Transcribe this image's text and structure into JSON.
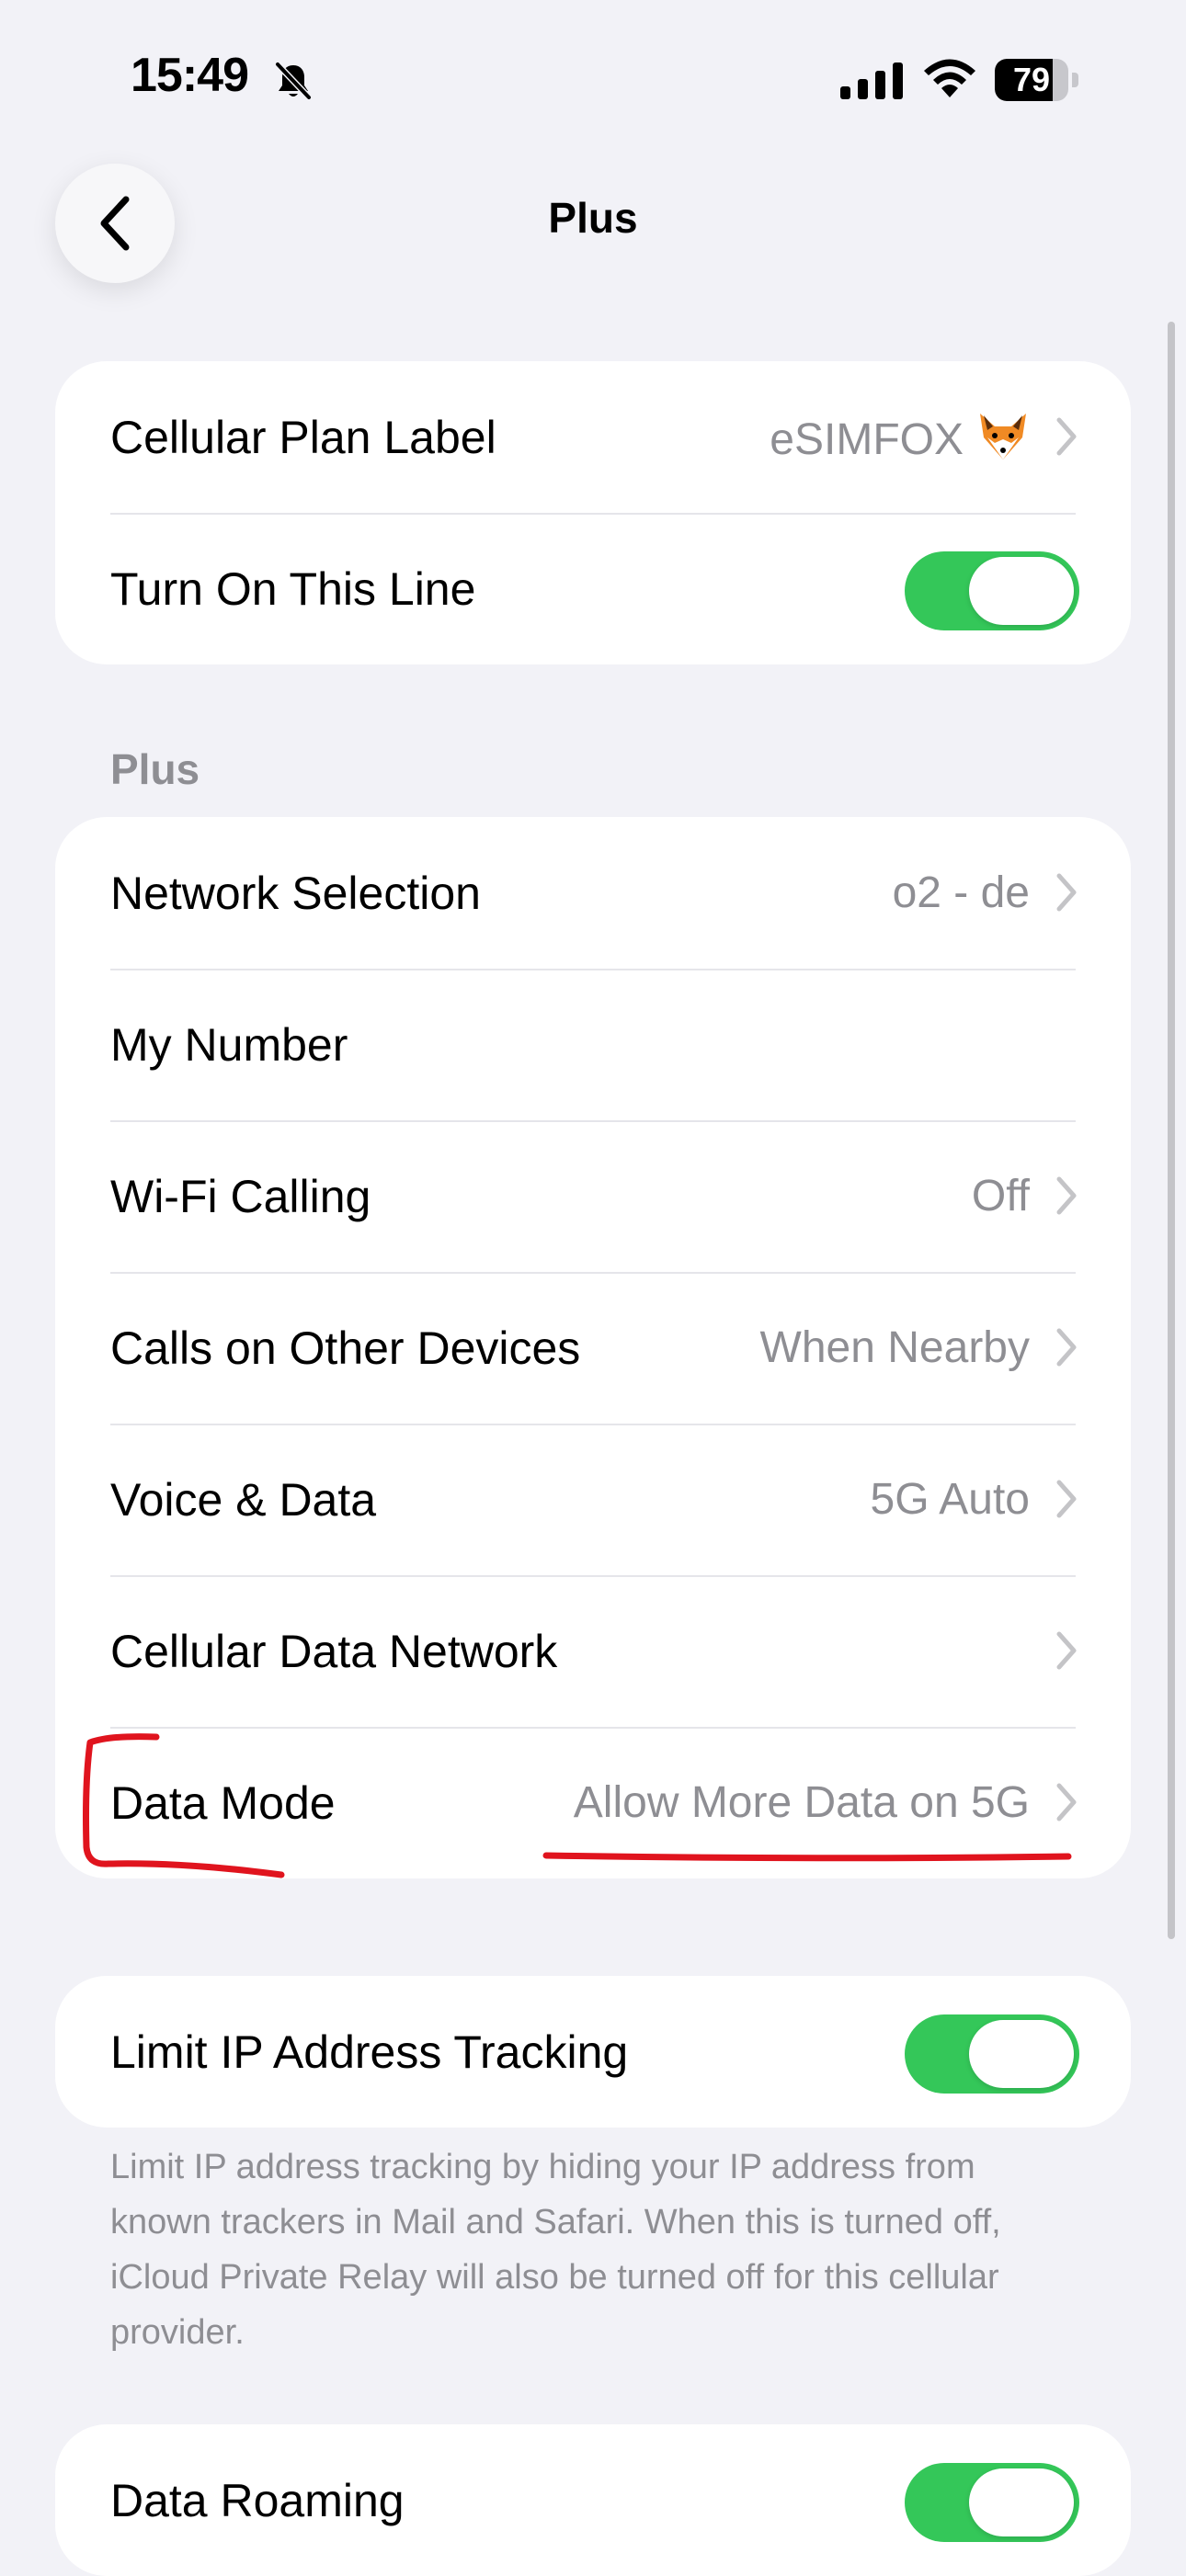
{
  "status_bar": {
    "time": "15:49",
    "battery": "79",
    "battery_level": 0.79
  },
  "nav": {
    "title": "Plus"
  },
  "plan_group": {
    "label_row": {
      "label": "Cellular Plan Label",
      "value": "eSIMFOX"
    },
    "line_row": {
      "label": "Turn On This Line",
      "on": true
    }
  },
  "section": {
    "header": "Plus"
  },
  "settings": [
    {
      "label": "Network Selection",
      "value": "o2 - de",
      "chevron": true
    },
    {
      "label": "My Number",
      "value": "",
      "chevron": false
    },
    {
      "label": "Wi-Fi Calling",
      "value": "Off",
      "chevron": true
    },
    {
      "label": "Calls on Other Devices",
      "value": "When Nearby",
      "chevron": true
    },
    {
      "label": "Voice & Data",
      "value": "5G Auto",
      "chevron": true
    },
    {
      "label": "Cellular Data Network",
      "value": "",
      "chevron": true
    },
    {
      "label": "Data Mode",
      "value": "Allow More Data on 5G",
      "chevron": true
    }
  ],
  "tracking": {
    "label": "Limit IP Address Tracking",
    "on": true,
    "footnote": "Limit IP address tracking by hiding your IP address from known trackers in Mail and Safari. When this is turned off, iCloud Private Relay will also be turned off for this cellular provider."
  },
  "roaming": {
    "label": "Data Roaming",
    "on": true
  },
  "colors": {
    "toggle_on": "#34c759",
    "annotation": "#e0141e"
  }
}
